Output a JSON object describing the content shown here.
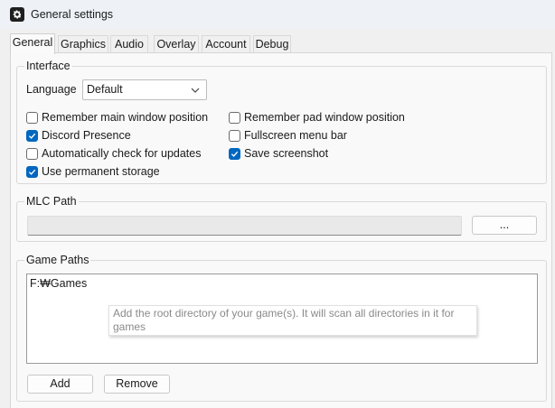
{
  "window": {
    "title": "General settings"
  },
  "tabs": [
    "General",
    "Graphics",
    "Audio",
    "Overlay",
    "Account",
    "Debug"
  ],
  "active_tab": "General",
  "interface": {
    "title": "Interface",
    "language_label": "Language",
    "language_value": "Default",
    "checkboxes": {
      "remember_main": {
        "label": "Remember main window position",
        "checked": false
      },
      "remember_pad": {
        "label": "Remember pad window position",
        "checked": false
      },
      "discord": {
        "label": "Discord Presence",
        "checked": true
      },
      "fullscreen_menu": {
        "label": "Fullscreen menu bar",
        "checked": false
      },
      "auto_update": {
        "label": "Automatically check for updates",
        "checked": false
      },
      "save_screenshot": {
        "label": "Save screenshot",
        "checked": true
      },
      "permanent_storage": {
        "label": "Use permanent storage",
        "checked": true
      }
    }
  },
  "mlc_path": {
    "title": "MLC Path",
    "value": "",
    "browse_label": "..."
  },
  "game_paths": {
    "title": "Game Paths",
    "items": [
      "F:₩Games"
    ],
    "tooltip": "Add the root directory of your game(s). It will scan all directories in it for games",
    "add_label": "Add",
    "remove_label": "Remove"
  },
  "colors": {
    "accent": "#0067c0",
    "titlebar": "#eef2f7",
    "panel": "#f9f9f9"
  },
  "icons": {
    "app": "gear-icon",
    "dropdown": "chevron-down-icon",
    "check": "checkmark-icon"
  }
}
